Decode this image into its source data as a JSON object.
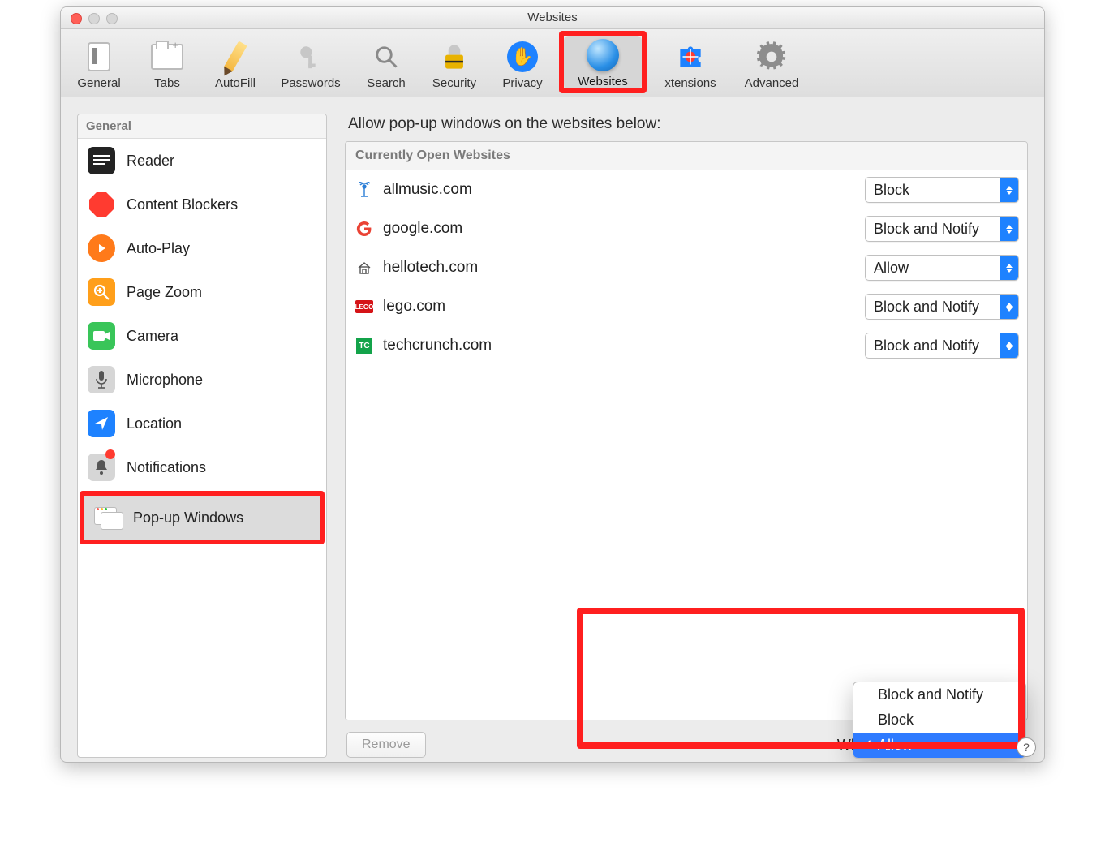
{
  "window_title": "Websites",
  "toolbar": [
    {
      "id": "general",
      "label": "General"
    },
    {
      "id": "tabs",
      "label": "Tabs"
    },
    {
      "id": "autofill",
      "label": "AutoFill"
    },
    {
      "id": "passwords",
      "label": "Passwords"
    },
    {
      "id": "search",
      "label": "Search"
    },
    {
      "id": "security",
      "label": "Security"
    },
    {
      "id": "privacy",
      "label": "Privacy"
    },
    {
      "id": "websites",
      "label": "Websites",
      "active": true
    },
    {
      "id": "extensions",
      "label": "xtensions"
    },
    {
      "id": "advanced",
      "label": "Advanced"
    }
  ],
  "sidebar": {
    "heading": "General",
    "items": [
      {
        "id": "reader",
        "label": "Reader"
      },
      {
        "id": "content-blockers",
        "label": "Content Blockers"
      },
      {
        "id": "auto-play",
        "label": "Auto-Play"
      },
      {
        "id": "page-zoom",
        "label": "Page Zoom"
      },
      {
        "id": "camera",
        "label": "Camera"
      },
      {
        "id": "microphone",
        "label": "Microphone"
      },
      {
        "id": "location",
        "label": "Location"
      },
      {
        "id": "notifications",
        "label": "Notifications",
        "badge": true
      },
      {
        "id": "popup-windows",
        "label": "Pop-up Windows",
        "selected": true
      }
    ]
  },
  "main": {
    "title": "Allow pop-up windows on the websites below:",
    "list_heading": "Currently Open Websites",
    "rows": [
      {
        "site": "allmusic.com",
        "value": "Block",
        "icon": "antenna"
      },
      {
        "site": "google.com",
        "value": "Block and Notify",
        "icon": "google"
      },
      {
        "site": "hellotech.com",
        "value": "Allow",
        "icon": "house"
      },
      {
        "site": "lego.com",
        "value": "Block and Notify",
        "icon": "lego"
      },
      {
        "site": "techcrunch.com",
        "value": "Block and Notify",
        "icon": "tc"
      }
    ],
    "remove_label": "Remove",
    "footer_label": "When visiting other websites:",
    "footer_menu": {
      "options": [
        "Block and Notify",
        "Block",
        "Allow"
      ],
      "selected": "Allow"
    }
  }
}
